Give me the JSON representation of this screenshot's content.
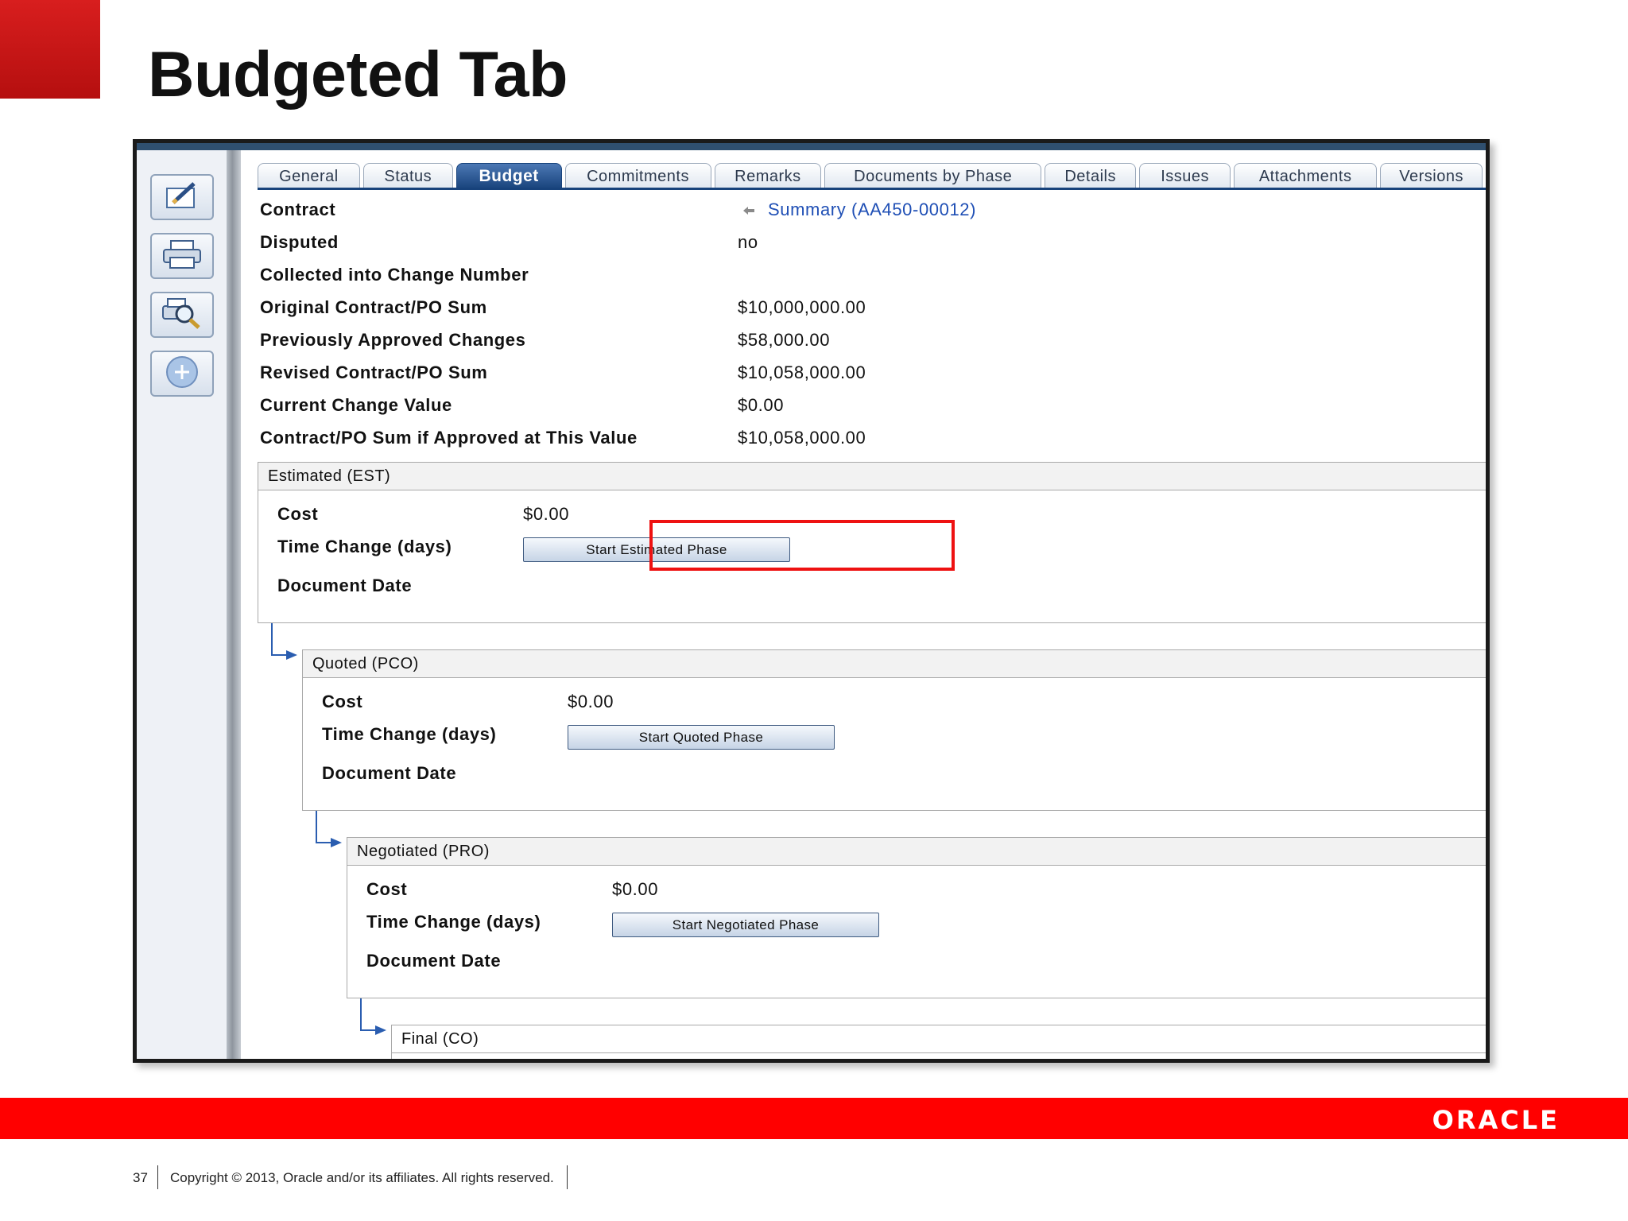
{
  "slide": {
    "title": "Budgeted Tab",
    "page_number": "37",
    "copyright": "Copyright © 2013, Oracle and/or its affiliates. All rights reserved.",
    "logo_text": "ORACLE",
    "accent_color": "#ff0000"
  },
  "toolbar": {
    "buttons": [
      {
        "icon": "edit-icon"
      },
      {
        "icon": "print-icon"
      },
      {
        "icon": "print-preview-icon"
      },
      {
        "icon": "add-icon"
      }
    ]
  },
  "tabs": [
    "General",
    "Status",
    "Budget",
    "Commitments",
    "Remarks",
    "Documents by Phase",
    "Details",
    "Issues",
    "Attachments",
    "Versions"
  ],
  "active_tab": "Budget",
  "fields": {
    "contract_label": "Contract",
    "contract_value": "Summary (AA450-00012)",
    "disputed_label": "Disputed",
    "disputed_value": "no",
    "collected_label": "Collected into Change Number",
    "original_label": "Original Contract/PO Sum",
    "original_value": "$10,000,000.00",
    "previous_label": "Previously Approved Changes",
    "previous_value": "$58,000.00",
    "revised_label": "Revised Contract/PO Sum",
    "revised_value": "$10,058,000.00",
    "current_label": "Current Change Value",
    "current_value": "$0.00",
    "approved_label": "Contract/PO Sum if Approved at This Value",
    "approved_value": "$10,058,000.00"
  },
  "phases": {
    "est": {
      "title": "Estimated (EST)",
      "cost_label": "Cost",
      "cost_value": "$0.00",
      "time_label": "Time Change (days)",
      "date_label": "Document Date",
      "button": "Start Estimated Phase"
    },
    "pco": {
      "title": "Quoted (PCO)",
      "cost_label": "Cost",
      "cost_value": "$0.00",
      "time_label": "Time Change (days)",
      "date_label": "Document Date",
      "button": "Start Quoted Phase"
    },
    "pro": {
      "title": "Negotiated (PRO)",
      "cost_label": "Cost",
      "cost_value": "$0.00",
      "time_label": "Time Change (days)",
      "date_label": "Document Date",
      "button": "Start Negotiated Phase"
    },
    "co": {
      "title": "Final (CO)"
    }
  }
}
